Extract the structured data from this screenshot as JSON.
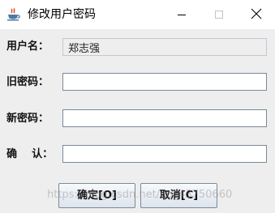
{
  "window": {
    "title": "修改用户密码",
    "icon": "java-coffee-cup-icon"
  },
  "title_controls": {
    "minimize_icon": "minimize-icon",
    "maximize_icon": "maximize-icon",
    "close_icon": "close-icon"
  },
  "form": {
    "username_label": "用户名：",
    "username_value": "郑志强",
    "old_password_label": "旧密码：",
    "old_password_value": "",
    "new_password_label": "新密码：",
    "new_password_value": "",
    "confirm_label": "确    认：",
    "confirm_value": ""
  },
  "buttons": {
    "ok_label": "确定[O]",
    "cancel_label": "取消[C]"
  },
  "watermark": "https://blog.csdn.net/qq_43750660"
}
